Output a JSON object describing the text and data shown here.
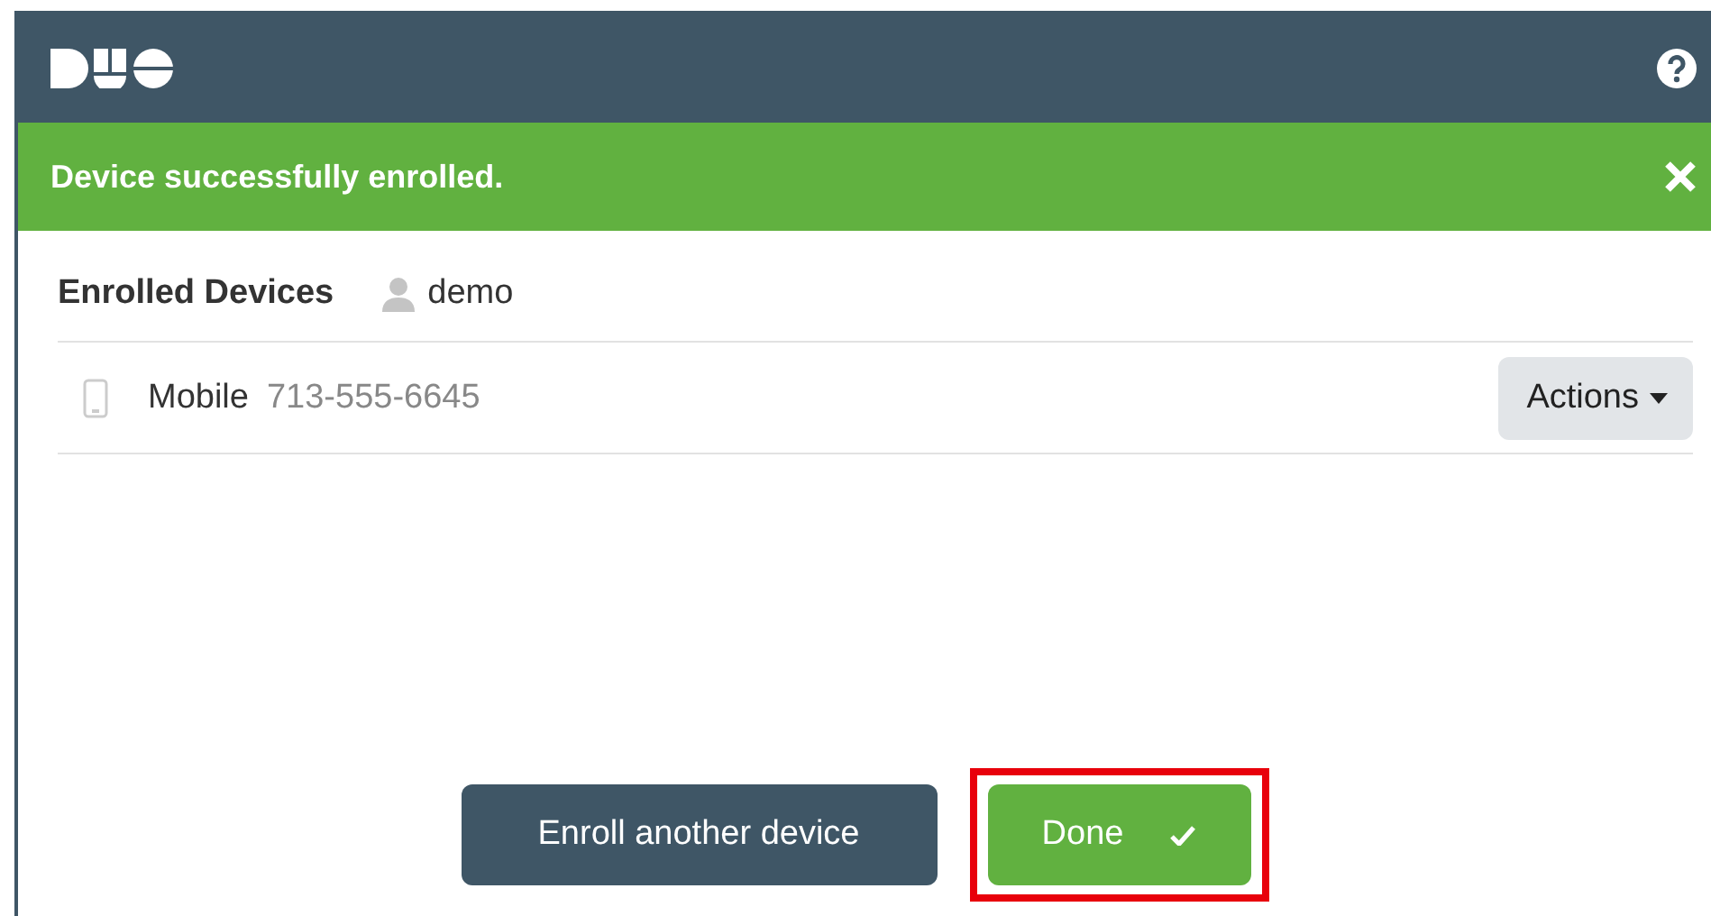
{
  "banner": {
    "message": "Device successfully enrolled."
  },
  "section": {
    "title": "Enrolled Devices",
    "user": "demo"
  },
  "devices": [
    {
      "name": "Mobile",
      "number": "713-555-6645",
      "action": "Actions"
    }
  ],
  "buttons": [
    {
      "label": "Enroll another device",
      "kind": "secondary",
      "highlighted": false
    },
    {
      "label": "Done",
      "kind": "primary",
      "highlighted": true
    }
  ]
}
